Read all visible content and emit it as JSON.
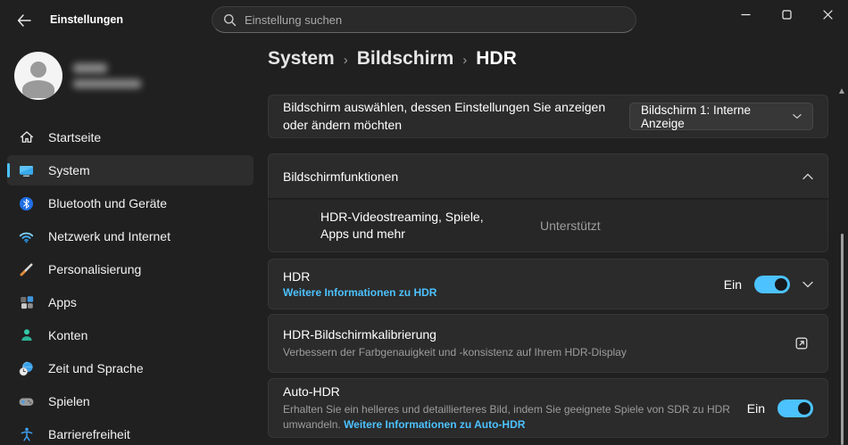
{
  "titlebar": {
    "app_title": "Einstellungen",
    "search_placeholder": "Einstellung suchen"
  },
  "sidebar": {
    "items": [
      {
        "label": "Startseite"
      },
      {
        "label": "System"
      },
      {
        "label": "Bluetooth und Geräte"
      },
      {
        "label": "Netzwerk und Internet"
      },
      {
        "label": "Personalisierung"
      },
      {
        "label": "Apps"
      },
      {
        "label": "Konten"
      },
      {
        "label": "Zeit und Sprache"
      },
      {
        "label": "Spielen"
      },
      {
        "label": "Barrierefreiheit"
      }
    ],
    "selected": "System"
  },
  "breadcrumb": {
    "items": [
      "System",
      "Bildschirm",
      "HDR"
    ],
    "separator": "›"
  },
  "display_select": {
    "label": "Bildschirm auswählen, dessen Einstellungen Sie anzeigen oder ändern möchten",
    "dropdown_value": "Bildschirm 1: Interne Anzeige"
  },
  "display_features": {
    "title": "Bildschirmfunktionen",
    "row_label": "HDR-Videostreaming, Spiele, Apps und mehr",
    "row_value": "Unterstützt"
  },
  "hdr": {
    "title": "HDR",
    "link": "Weitere Informationen zu HDR",
    "state": "Ein"
  },
  "calibration": {
    "title": "HDR-Bildschirmkalibrierung",
    "subtitle": "Verbessern der Farbgenauigkeit und -konsistenz auf Ihrem HDR-Display"
  },
  "auto_hdr": {
    "title": "Auto-HDR",
    "description": "Erhalten Sie ein helleres und detaillierteres Bild, indem Sie geeignete Spiele von SDR zu HDR umwandeln.",
    "link": "Weitere Informationen zu Auto-HDR",
    "state": "Ein"
  },
  "colors": {
    "accent": "#4cc2ff",
    "link": "#4cc2ff",
    "background": "#202020",
    "card": "#2b2b2b",
    "text_secondary": "#9d9d9d"
  }
}
